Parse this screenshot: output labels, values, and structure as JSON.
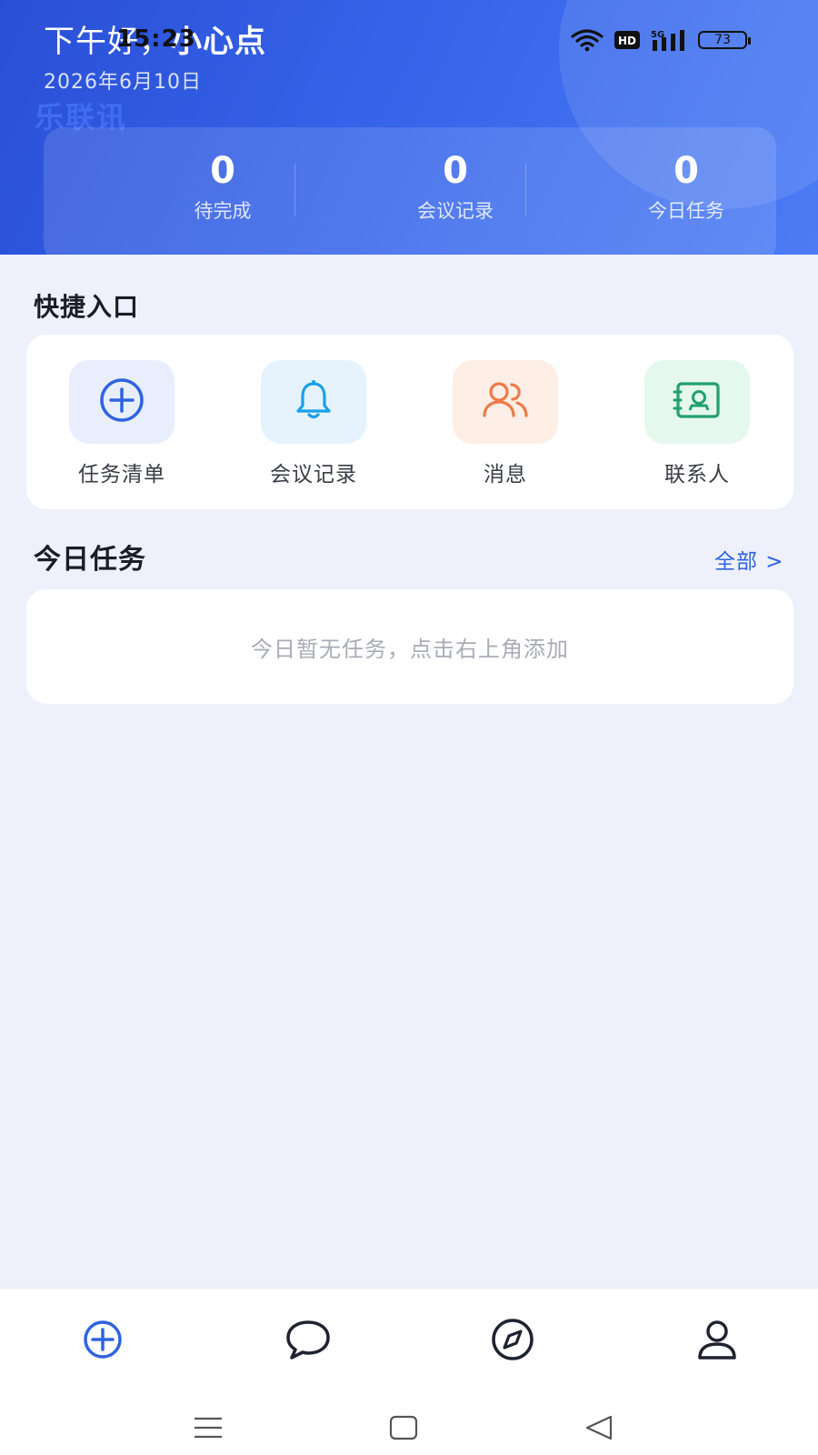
{
  "status_bar": {
    "time": "15:23",
    "battery": "73",
    "network": "5G",
    "hd": "HD"
  },
  "header": {
    "greeting_prefix": "下午好，",
    "user_name": "小心点",
    "date": "2026年6月10日",
    "brand": "乐联讯",
    "stats": [
      {
        "value": "0",
        "label": "待完成"
      },
      {
        "value": "0",
        "label": "会议记录"
      },
      {
        "value": "0",
        "label": "今日任务"
      }
    ]
  },
  "quick_entry": {
    "title": "快捷入口",
    "items": [
      {
        "label": "任务清单",
        "icon": "plus-circle-icon",
        "color": "#2f63e0",
        "bg": "#e8eefc"
      },
      {
        "label": "会议记录",
        "icon": "bell-icon",
        "color": "#1aa0e8",
        "bg": "#e6f3fd"
      },
      {
        "label": "消息",
        "icon": "users-icon",
        "color": "#ef7a4a",
        "bg": "#fdeee6"
      },
      {
        "label": "联系人",
        "icon": "contact-card-icon",
        "color": "#22a06b",
        "bg": "#e4f8ee"
      }
    ]
  },
  "today_tasks": {
    "title": "今日任务",
    "view_all": "全部 >",
    "empty_text": "今日暂无任务，点击右上角添加"
  },
  "bottom_nav": {
    "tabs": [
      {
        "icon": "plus-circle-icon",
        "active": true
      },
      {
        "icon": "chat-bubble-icon",
        "active": false
      },
      {
        "icon": "compass-icon",
        "active": false
      },
      {
        "icon": "user-icon",
        "active": false
      }
    ]
  },
  "colors": {
    "accent": "#2f63e0",
    "header_start": "#2a4fd6",
    "header_end": "#4b7cf5",
    "page_bg": "#eef1fb"
  }
}
